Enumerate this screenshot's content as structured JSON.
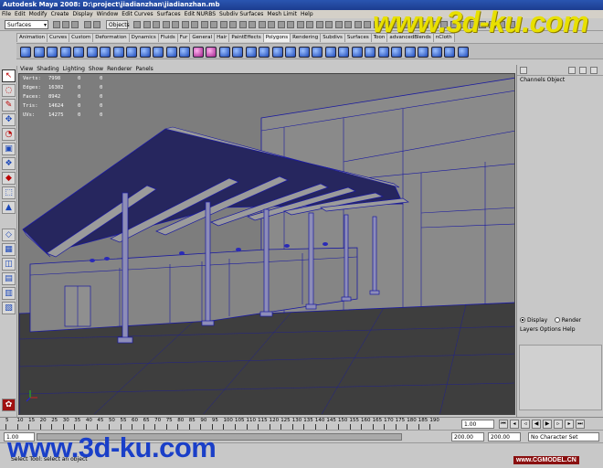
{
  "window": {
    "title": "Autodesk Maya 2008: D:\\project\\jiadianzhan\\jiadianzhan.mb"
  },
  "menubar": [
    "File",
    "Edit",
    "Modify",
    "Create",
    "Display",
    "Window",
    "Edit Curves",
    "Surfaces",
    "Edit NURBS",
    "Subdiv Surfaces",
    "Mesh Limit",
    "Help"
  ],
  "statusline": {
    "mode": "Surfaces",
    "object_field": "Objects"
  },
  "shelf": {
    "tabs": [
      "Animation",
      "Curves",
      "Custom",
      "Deformation",
      "Dynamics",
      "Fluids",
      "Fur",
      "General",
      "Hair",
      "PaintEffects",
      "Polygons",
      "Rendering",
      "Subdivs",
      "Surfaces",
      "Toon",
      "advancedBlends",
      "nCloth"
    ],
    "active_tab": "Polygons"
  },
  "panel_menu": [
    "View",
    "Shading",
    "Lighting",
    "Show",
    "Renderer",
    "Panels"
  ],
  "hud": [
    {
      "label": "Verts:",
      "value": "7998",
      "sel": "0",
      "extra": "0"
    },
    {
      "label": "Edges:",
      "value": "16302",
      "sel": "0",
      "extra": "0"
    },
    {
      "label": "Faces:",
      "value": "8942",
      "sel": "0",
      "extra": "0"
    },
    {
      "label": "Tris:",
      "value": "14624",
      "sel": "0",
      "extra": "0"
    },
    {
      "label": "UVs:",
      "value": "14275",
      "sel": "0",
      "extra": "0"
    }
  ],
  "channel_box": {
    "menu": "Channels  Object"
  },
  "layer_editor": {
    "display_label": "Display",
    "render_label": "Render",
    "menu": "Layers  Options  Help"
  },
  "time_slider": {
    "ticks": [
      "5",
      "10",
      "15",
      "20",
      "25",
      "30",
      "35",
      "40",
      "45",
      "50",
      "55",
      "60",
      "65",
      "70",
      "75",
      "80",
      "85",
      "90",
      "95",
      "100",
      "105",
      "110",
      "115",
      "120",
      "125",
      "130",
      "135",
      "140",
      "145",
      "150",
      "155",
      "160",
      "165",
      "170",
      "175",
      "180",
      "185",
      "190"
    ],
    "current_frame": "1.00"
  },
  "range_slider": {
    "start": "1.00",
    "end_a": "200.00",
    "end_b": "200.00",
    "character_set": "No Character Set"
  },
  "help_line": "Select Tool: select an object",
  "watermarks": {
    "top": "www.3d-ku.com",
    "bottom": "www.3d-ku.com",
    "corner": "www.CGMODEL.CN"
  },
  "colors": {
    "viewport_bg": "#7d7d7d",
    "wireframe": "#1a1aa0",
    "title_bar": "#2a55b0",
    "watermark_yellow": "#e8e000",
    "watermark_blue": "#1a3fc8"
  }
}
